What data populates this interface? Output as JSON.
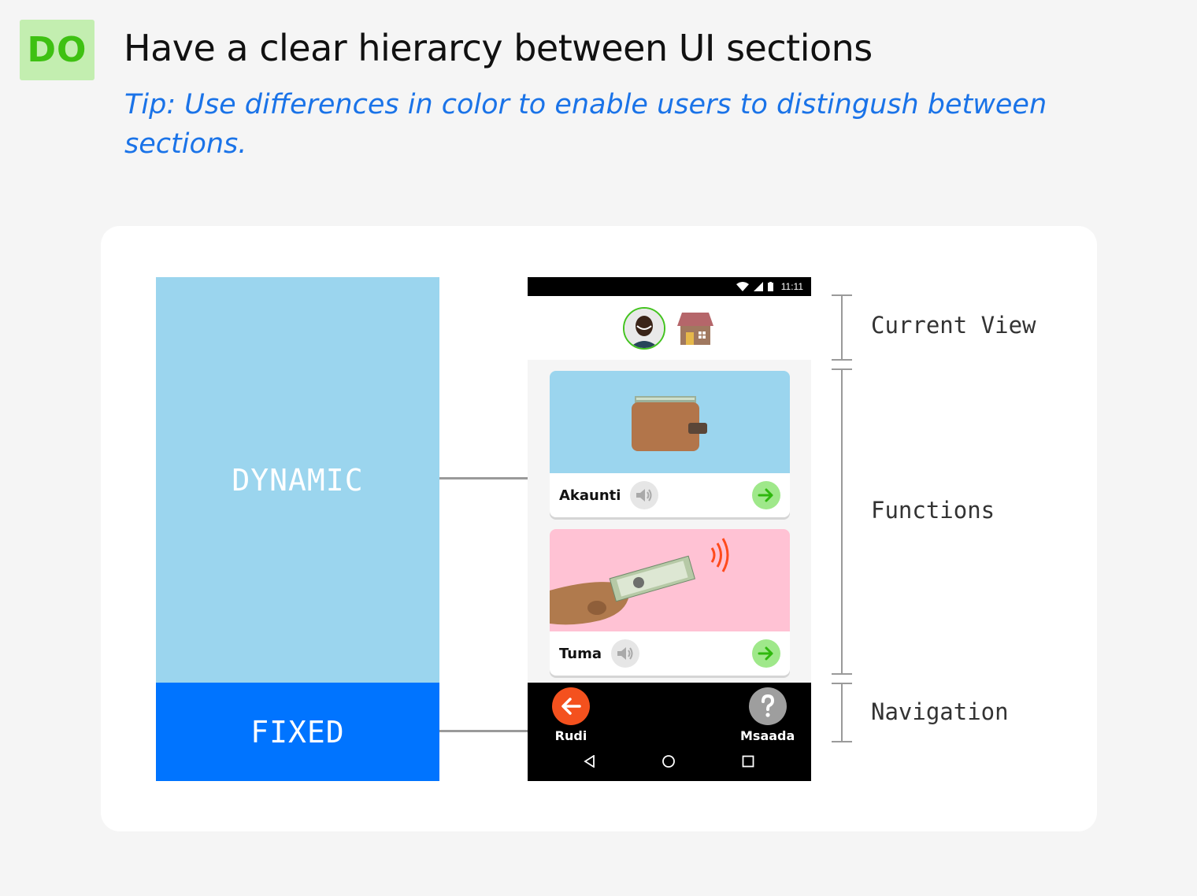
{
  "header": {
    "badge": "DO",
    "title": "Have a clear hierarcy between UI sections",
    "tip": "Tip: Use differences in color to enable users to distingush between sections."
  },
  "blocks": {
    "dynamic": "DYNAMIC",
    "fixed": "FIXED"
  },
  "phone": {
    "status_time": "11:11",
    "cards": [
      {
        "label": "Akaunti",
        "image_color": "#9bd5ee",
        "image": "wallet-icon"
      },
      {
        "label": "Tuma",
        "image_color": "#ffc2d4",
        "image": "hand-money-icon"
      }
    ],
    "nav": {
      "back_label": "Rudi",
      "help_label": "Msaada"
    }
  },
  "sections": {
    "current_view": "Current View",
    "functions": "Functions",
    "navigation": "Navigation"
  },
  "colors": {
    "dynamic": "#9bd5ee",
    "fixed": "#0074ff",
    "accent_green": "#3ec112",
    "back_button": "#f4511e",
    "help_button": "#9e9e9e"
  }
}
